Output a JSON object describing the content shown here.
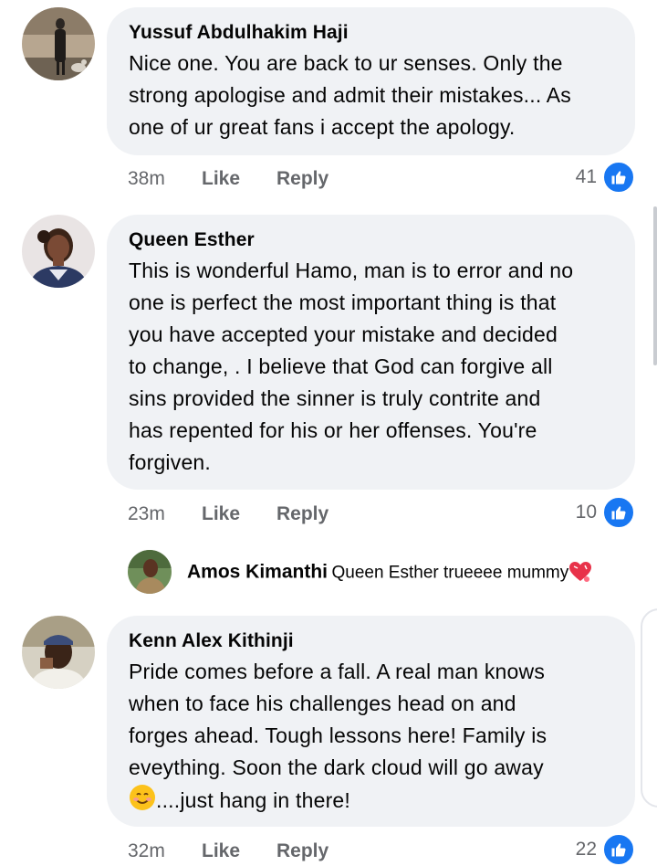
{
  "comments": [
    {
      "author": "Yussuf Abdulhakim Haji",
      "lines": [
        "Nice one. You are back to ur senses. Only the",
        "strong apologise and admit their mistakes... As",
        "one of ur great fans i accept the apology."
      ],
      "time": "38m",
      "like_label": "Like",
      "reply_label": "Reply",
      "like_count": "41"
    },
    {
      "author": "Queen Esther",
      "lines": [
        "This is wonderful Hamo, man is to error and no",
        "one is perfect the most important thing is that",
        "you have accepted your mistake and decided",
        "to change, . I believe that God can forgive all",
        "sins provided the sinner is truly contrite and",
        "has repented for his or her offenses. You're",
        "forgiven."
      ],
      "time": "23m",
      "like_label": "Like",
      "reply_label": "Reply",
      "like_count": "10",
      "reply": {
        "author": "Amos Kimanthi",
        "text": "Queen Esther trueeee mummy",
        "emoji": "heart-emoji"
      }
    },
    {
      "author": "Kenn Alex Kithinji",
      "lines": [
        "Pride comes before a fall. A real man knows",
        "when to face his challenges head on and",
        "forges ahead. Tough lessons here! Family is",
        "eveything. Soon the dark cloud will go away"
      ],
      "last_line": "....just hang in there!",
      "last_line_emoji": "smiling-face-emoji",
      "time": "32m",
      "like_label": "Like",
      "reply_label": "Reply",
      "like_count": "22"
    }
  ],
  "colors": {
    "bubble": "#f0f2f5",
    "secondary_text": "#65676b",
    "like_blue": "#1877f2"
  }
}
